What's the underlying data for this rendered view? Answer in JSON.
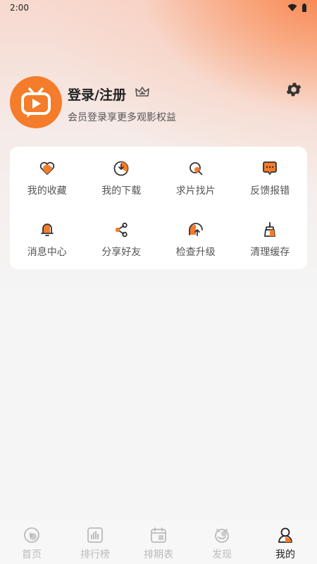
{
  "status_bar": {
    "time": "2:00"
  },
  "profile": {
    "title": "登录/注册",
    "subtitle": "会员登录享更多观影权益"
  },
  "colors": {
    "accent": "#f57c2a",
    "tab_inactive": "#bbbbbb",
    "tab_active": "#222222"
  },
  "menu": {
    "items": [
      {
        "label": "我的收藏",
        "icon": "heart-icon"
      },
      {
        "label": "我的下载",
        "icon": "download-icon"
      },
      {
        "label": "求片找片",
        "icon": "search-film-icon"
      },
      {
        "label": "反馈报错",
        "icon": "feedback-icon"
      },
      {
        "label": "消息中心",
        "icon": "bell-icon"
      },
      {
        "label": "分享好友",
        "icon": "share-icon"
      },
      {
        "label": "检查升级",
        "icon": "upgrade-icon"
      },
      {
        "label": "清理缓存",
        "icon": "broom-icon"
      }
    ]
  },
  "tabbar": {
    "items": [
      {
        "label": "首页",
        "icon": "home-icon"
      },
      {
        "label": "排行榜",
        "icon": "ranking-icon"
      },
      {
        "label": "排期表",
        "icon": "calendar-icon"
      },
      {
        "label": "发现",
        "icon": "discover-icon"
      },
      {
        "label": "我的",
        "icon": "profile-icon",
        "active": true
      }
    ]
  }
}
